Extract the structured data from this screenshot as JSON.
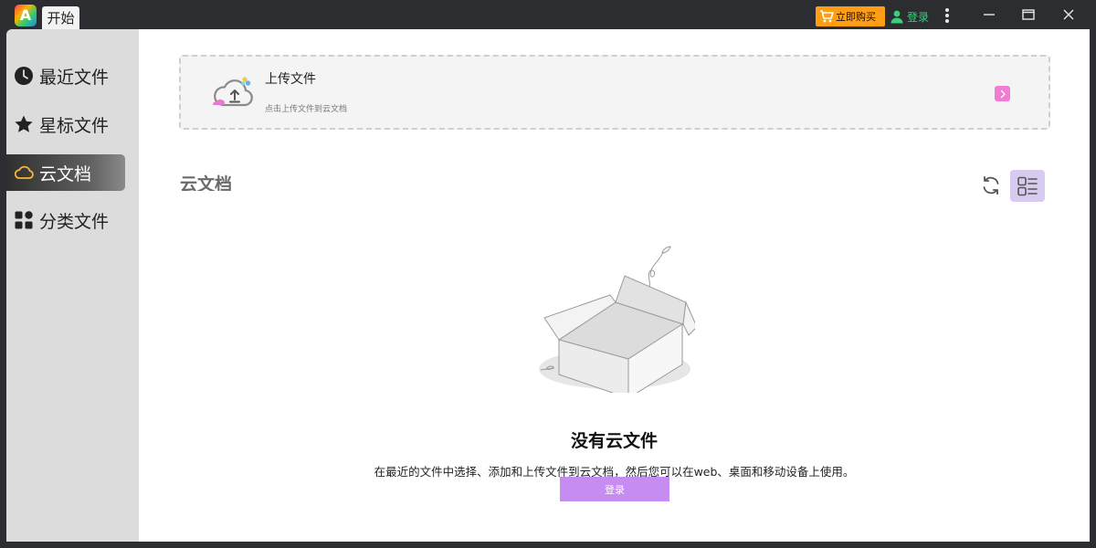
{
  "titlebar": {
    "logo_letter": "A",
    "tab_label": "开始",
    "buy_label": "立即购买",
    "login_label": "登录"
  },
  "sidebar": {
    "items": [
      {
        "label": "最近文件",
        "icon": "clock-icon"
      },
      {
        "label": "星标文件",
        "icon": "star-icon"
      },
      {
        "label": "云文档",
        "icon": "cloud-icon",
        "active": true
      },
      {
        "label": "分类文件",
        "icon": "category-icon"
      }
    ]
  },
  "upload": {
    "title": "上传文件",
    "description": "点击上传文件到云文档"
  },
  "section": {
    "title": "云文档"
  },
  "empty_state": {
    "title": "没有云文件",
    "description": "在最近的文件中选择、添加和上传文件到云文档，然后您可以在web、桌面和移动设备上使用。",
    "login_button": "登录"
  },
  "colors": {
    "buy_accent": "#ff9e14",
    "login_green": "#3ad07a",
    "login_button": "#c58cf2",
    "view_toggle": "#d9cbef",
    "arrow_pink": "#f07cd4"
  }
}
